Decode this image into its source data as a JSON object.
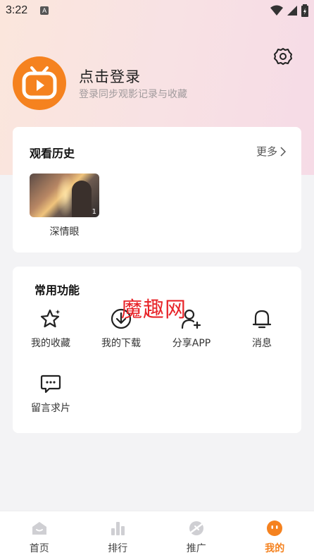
{
  "status_bar": {
    "time": "3:22",
    "app_icon_letter": "A"
  },
  "profile": {
    "login_title": "点击登录",
    "login_subtitle": "登录同步观影记录与收藏"
  },
  "history": {
    "title": "观看历史",
    "more_label": "更多",
    "items": [
      {
        "title": "深情眼",
        "badge": "1"
      }
    ]
  },
  "functions": {
    "title": "常用功能",
    "items": [
      {
        "label": "我的收藏",
        "icon": "star-icon"
      },
      {
        "label": "我的下载",
        "icon": "download-icon"
      },
      {
        "label": "分享APP",
        "icon": "share-user-icon"
      },
      {
        "label": "消息",
        "icon": "bell-icon"
      },
      {
        "label": "留言求片",
        "icon": "message-icon"
      }
    ]
  },
  "watermark": "魔趣网",
  "tabbar": {
    "items": [
      {
        "label": "首页",
        "icon": "home-icon",
        "active": false
      },
      {
        "label": "排行",
        "icon": "ranking-icon",
        "active": false
      },
      {
        "label": "推广",
        "icon": "promote-icon",
        "active": false
      },
      {
        "label": "我的",
        "icon": "profile-icon",
        "active": true
      }
    ]
  },
  "colors": {
    "accent": "#f5821f",
    "watermark": "#e8252a"
  }
}
